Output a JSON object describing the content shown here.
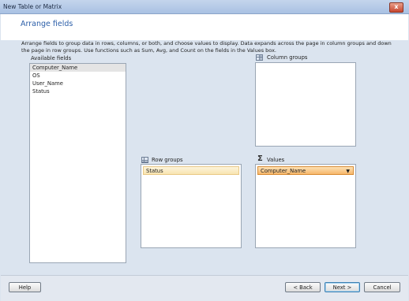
{
  "window": {
    "title": "New Table or Matrix",
    "close_glyph": "x"
  },
  "header": {
    "title": "Arrange fields"
  },
  "description": "Arrange fields to group data in rows, columns, or both, and choose values to display. Data expands across the page in column groups and down the page in row groups.  Use functions such as Sum, Avg, and Count on the fields in the Values box.",
  "available_fields": {
    "label": "Available fields",
    "items": [
      "Computer_Name",
      "OS",
      "User_Name",
      "Status"
    ],
    "selected_index": 0
  },
  "column_groups": {
    "label": "Column groups",
    "icon": "column-groups-icon",
    "items": []
  },
  "row_groups": {
    "label": "Row groups",
    "icon": "row-groups-icon",
    "items": [
      "Status"
    ]
  },
  "values": {
    "label": "Values",
    "icon": "sigma-icon",
    "sigma_glyph": "Σ",
    "items": [
      "Computer_Name"
    ],
    "dropdown_glyph": "▼"
  },
  "buttons": {
    "help": "Help",
    "back": "< Back",
    "next": "Next >",
    "cancel": "Cancel"
  },
  "colors": {
    "header_title": "#2b5ea8",
    "value_chip": "#f6b76a",
    "row_chip": "#f8e4b0"
  }
}
